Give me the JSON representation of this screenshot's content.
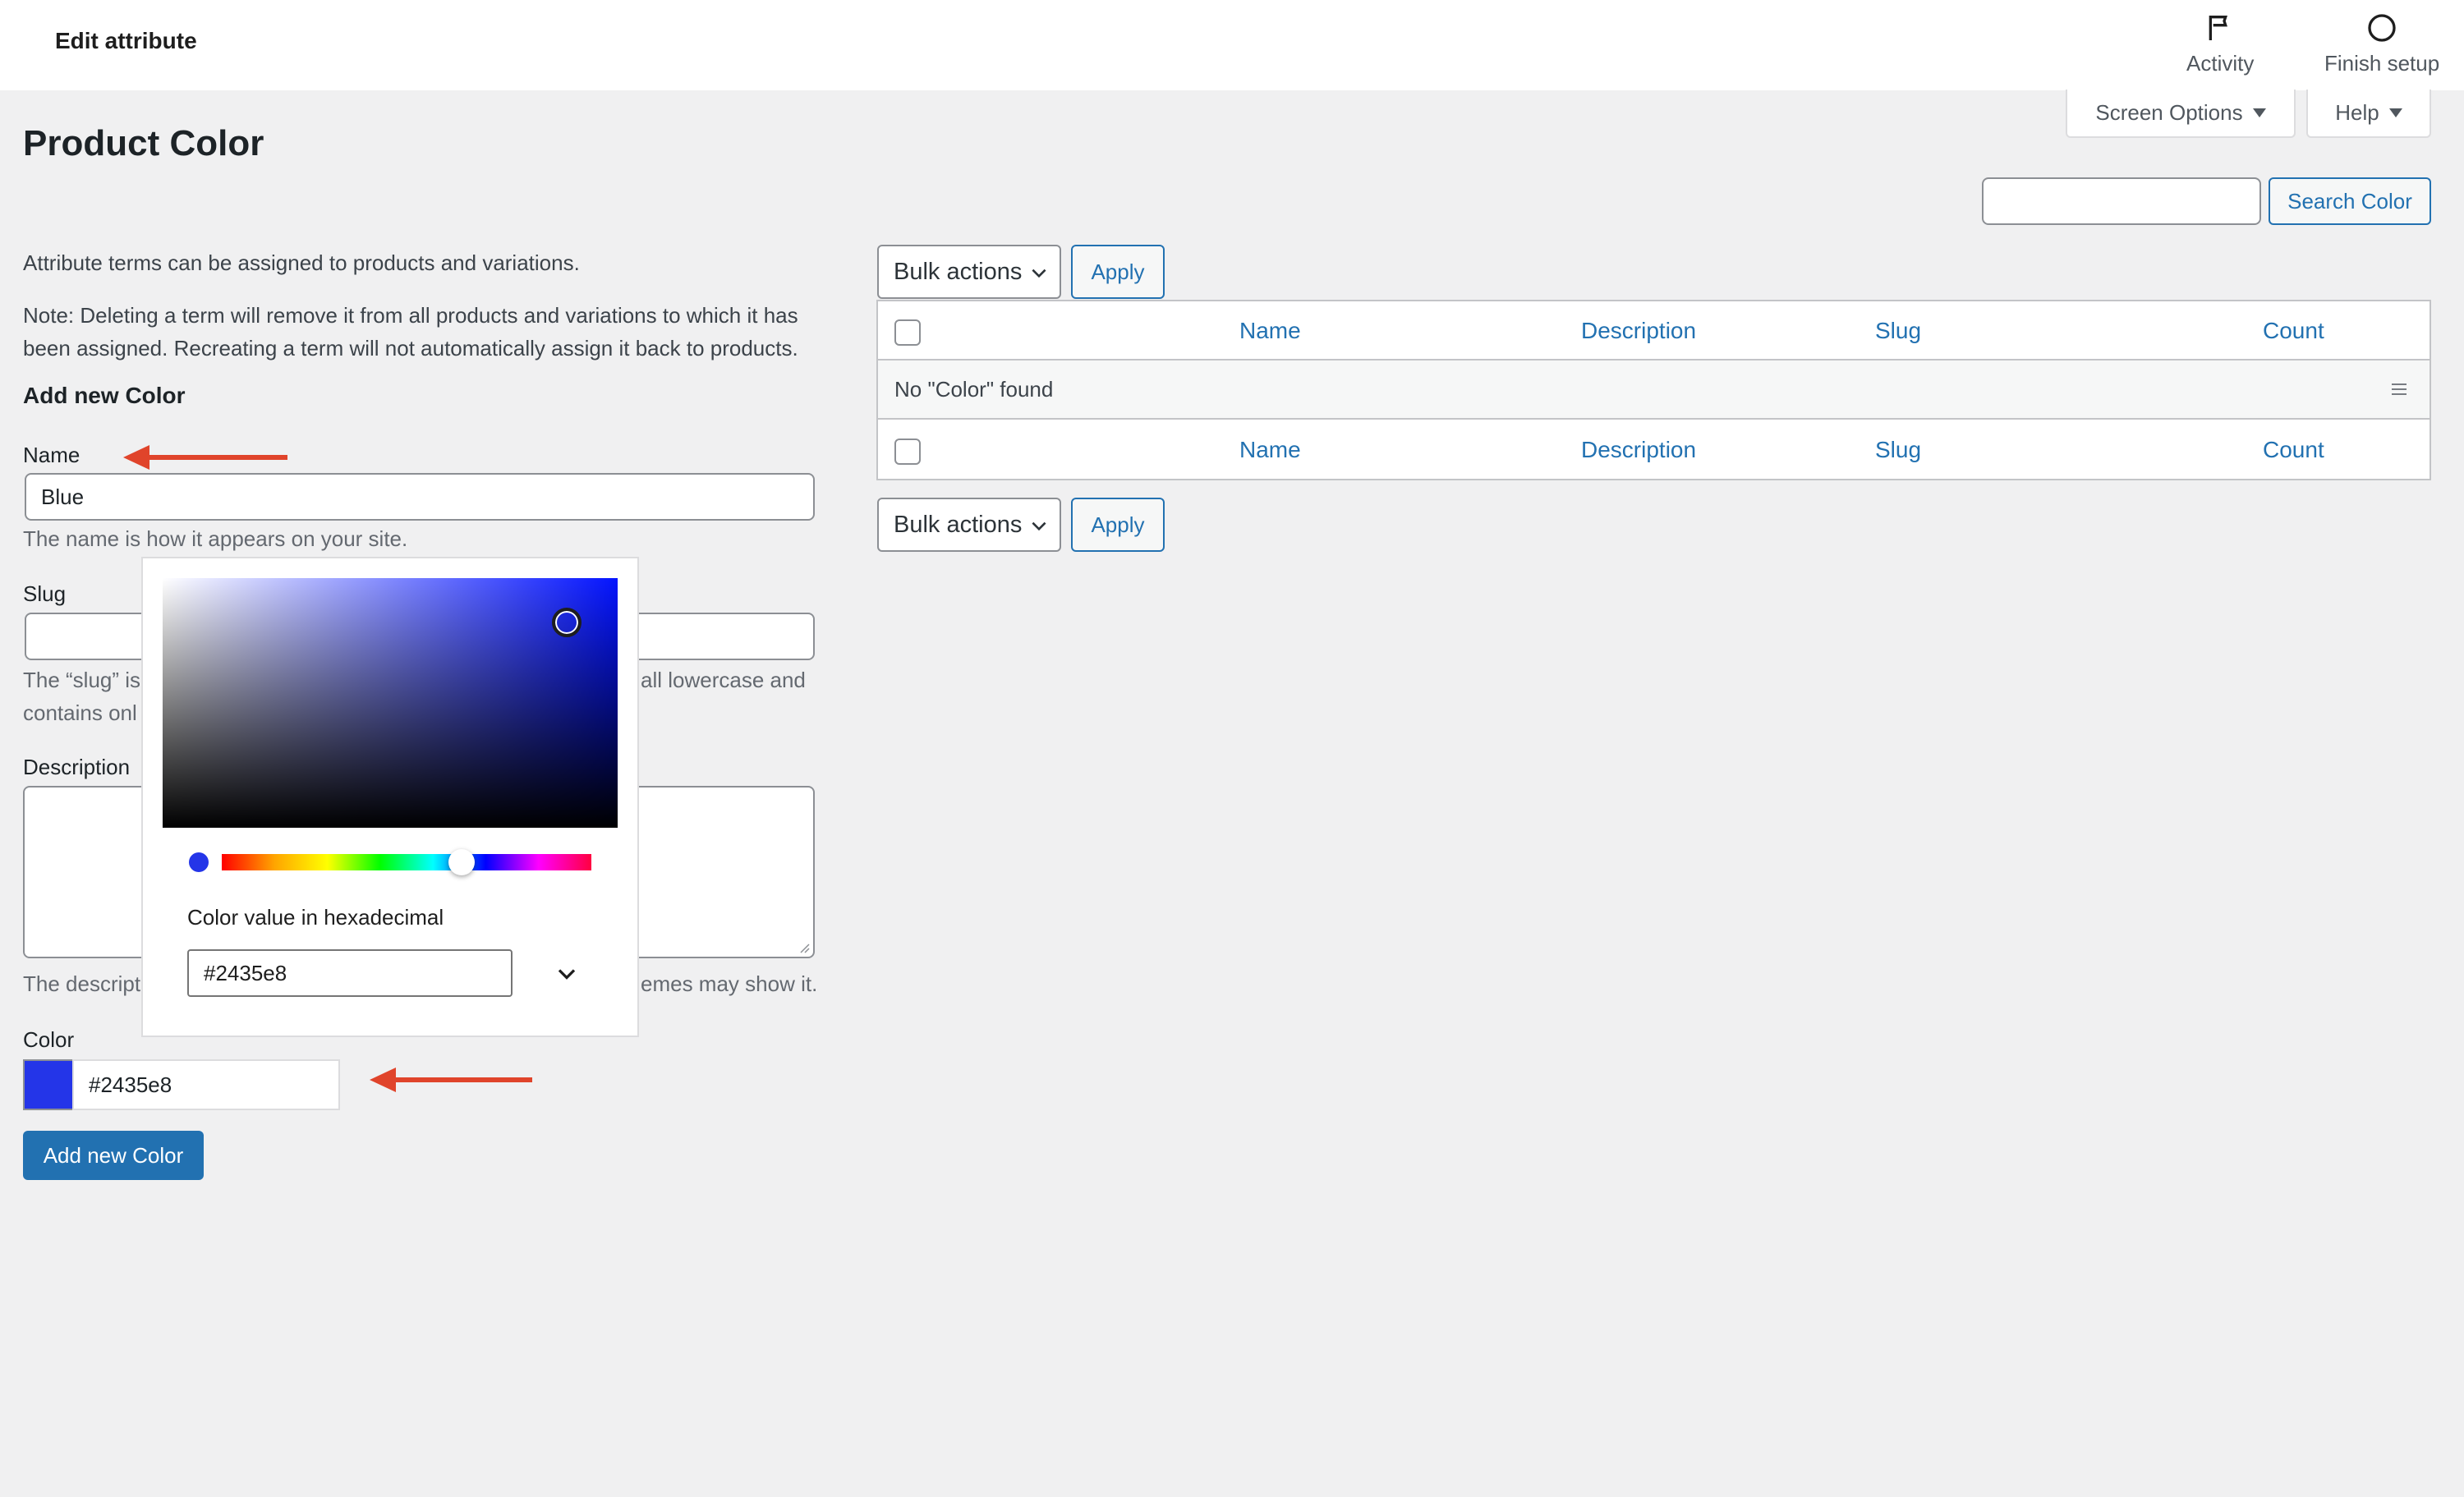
{
  "header": {
    "title": "Edit attribute",
    "actions": [
      {
        "label": "Activity",
        "icon": "flag-icon"
      },
      {
        "label": "Finish setup",
        "icon": "circle-icon"
      }
    ]
  },
  "screen_tabs": {
    "screen_options": "Screen Options",
    "help": "Help"
  },
  "page": {
    "title": "Product Color"
  },
  "search": {
    "input_value": "",
    "button": "Search Color"
  },
  "form": {
    "intro": "Attribute terms can be assigned to products and variations.",
    "note_line1": "Note: Deleting a term will remove it from all products and variations to which it has",
    "note_line2": "been assigned. Recreating a term will not automatically assign it back to products.",
    "section_title": "Add new Color",
    "name_label": "Name",
    "name_value": "Blue",
    "name_help": "The name is how it appears on your site.",
    "slug_label": "Slug",
    "slug_value": "",
    "slug_help_left1": "The “slug” is",
    "slug_help_right1": "all lowercase and",
    "slug_help_left2": "contains onl",
    "description_label": "Description",
    "description_help_left": "The descript",
    "description_help_right": "emes may show it.",
    "color_label": "Color",
    "color_value": "#2435e8",
    "submit": "Add new Color"
  },
  "color_picker": {
    "label": "Color value in hexadecimal",
    "hex_value": "#2435e8",
    "selected_color": "#2435e8"
  },
  "table": {
    "bulk_actions": "Bulk actions",
    "apply": "Apply",
    "columns": [
      "Name",
      "Description",
      "Slug",
      "Count"
    ],
    "empty_message": "No \"Color\" found"
  },
  "annotation_color": "#e0442b",
  "accent_color": "#2271b1"
}
